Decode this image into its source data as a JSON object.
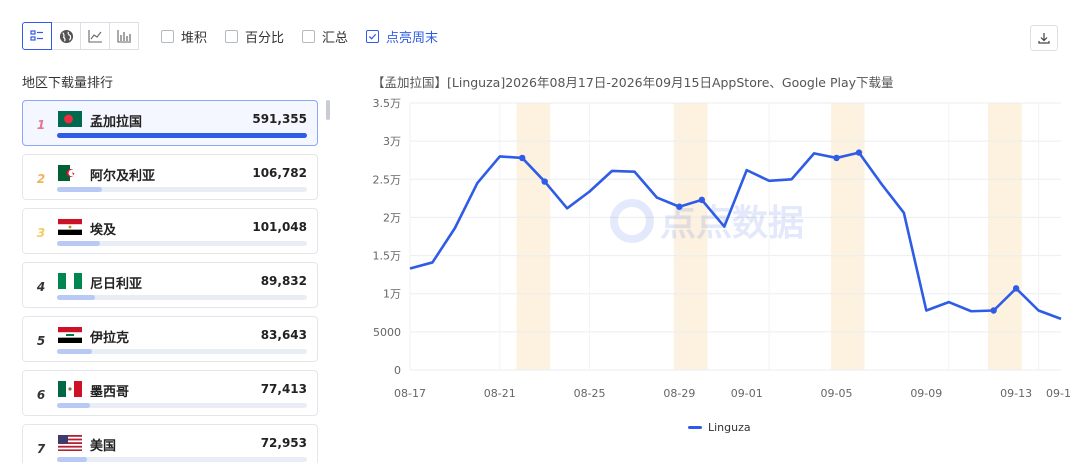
{
  "toolbar": {
    "views": [
      {
        "icon": "list-icon",
        "active": true
      },
      {
        "icon": "globe-icon",
        "active": false
      },
      {
        "icon": "line-chart-icon",
        "active": false
      },
      {
        "icon": "bar-chart-icon",
        "active": false
      }
    ],
    "options": [
      {
        "label": "堆积",
        "checked": false
      },
      {
        "label": "百分比",
        "checked": false
      },
      {
        "label": "汇总",
        "checked": false
      },
      {
        "label": "点亮周末",
        "checked": true
      }
    ],
    "download_icon": "download-icon"
  },
  "ranking": {
    "title": "地区下载量排行",
    "items": [
      {
        "rank": "1",
        "name": "孟加拉国",
        "value": "591,355",
        "share": 1.0,
        "flag": "bd"
      },
      {
        "rank": "2",
        "name": "阿尔及利亚",
        "value": "106,782",
        "share": 0.18,
        "flag": "dz"
      },
      {
        "rank": "3",
        "name": "埃及",
        "value": "101,048",
        "share": 0.17,
        "flag": "eg"
      },
      {
        "rank": "4",
        "name": "尼日利亚",
        "value": "89,832",
        "share": 0.15,
        "flag": "ng"
      },
      {
        "rank": "5",
        "name": "伊拉克",
        "value": "83,643",
        "share": 0.14,
        "flag": "iq"
      },
      {
        "rank": "6",
        "name": "墨西哥",
        "value": "77,413",
        "share": 0.13,
        "flag": "mx"
      },
      {
        "rank": "7",
        "name": "美国",
        "value": "72,953",
        "share": 0.12,
        "flag": "us"
      }
    ]
  },
  "chart": {
    "title": "【孟加拉国】[Linguza]2026年08月17日-2026年09月15日AppStore、Google Play下载量",
    "watermark": "点点数据",
    "legend": "Linguza"
  },
  "chart_data": {
    "type": "line",
    "title": "【孟加拉国】[Linguza]2026年08月17日-2026年09月15日AppStore、Google Play下载量",
    "x": [
      "08-17",
      "08-18",
      "08-19",
      "08-20",
      "08-21",
      "08-22",
      "08-23",
      "08-24",
      "08-25",
      "08-26",
      "08-27",
      "08-28",
      "08-29",
      "08-30",
      "08-31",
      "09-01",
      "09-02",
      "09-03",
      "09-04",
      "09-05",
      "09-06",
      "09-07",
      "09-08",
      "09-09",
      "09-10",
      "09-11",
      "09-12",
      "09-13",
      "09-14",
      "09-15"
    ],
    "xticks": [
      "08-17",
      "08-21",
      "08-25",
      "08-29",
      "09-01",
      "09-05",
      "09-09",
      "09-13",
      "09-15"
    ],
    "yticks": [
      "0",
      "5000",
      "1万",
      "1.5万",
      "2万",
      "2.5万",
      "3万",
      "3.5万"
    ],
    "ylim": [
      0,
      35000
    ],
    "series": [
      {
        "name": "Linguza",
        "color": "#2e5ce6",
        "values": [
          13300,
          14100,
          18600,
          24500,
          28000,
          27800,
          24700,
          21200,
          23400,
          26100,
          26000,
          22600,
          21400,
          22300,
          18800,
          26200,
          24800,
          25000,
          28400,
          27800,
          28500,
          24400,
          20600,
          7800,
          8900,
          7700,
          7800,
          10700,
          7800,
          6700
        ]
      }
    ],
    "markers": [
      5,
      6,
      12,
      13,
      19,
      20,
      26,
      27
    ],
    "weekend_bands": [
      [
        5,
        6
      ],
      [
        12,
        13
      ],
      [
        19,
        20
      ],
      [
        26,
        27
      ]
    ],
    "grid": true,
    "legend_position": "bottom"
  }
}
